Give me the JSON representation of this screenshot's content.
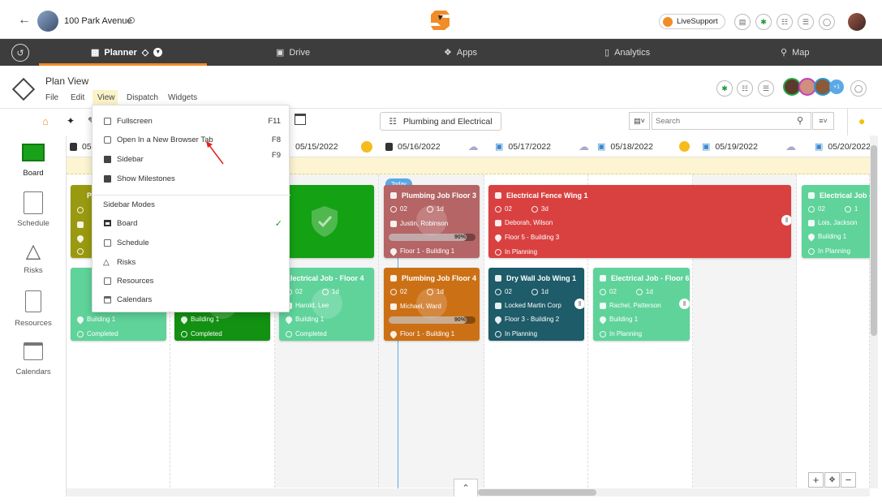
{
  "topbar": {
    "back_icon": "arrow-left-icon",
    "project_name": "100 Park Avenue",
    "support_label": "LiveSupport"
  },
  "nav": {
    "tabs": [
      {
        "label": "Planner",
        "icon": "calendar-icon",
        "active": true
      },
      {
        "label": "Drive",
        "icon": "drive-icon"
      },
      {
        "label": "Apps",
        "icon": "apps-icon"
      },
      {
        "label": "Analytics",
        "icon": "chart-icon"
      },
      {
        "label": "Map",
        "icon": "map-icon"
      }
    ]
  },
  "header": {
    "title": "Plan View",
    "menu": [
      "File",
      "Edit",
      "View",
      "Dispatch",
      "Widgets"
    ],
    "avatar_overflow": "+1"
  },
  "toolbar": {
    "filter_label": "Plumbing and Electrical",
    "search_placeholder": "Search"
  },
  "sidebar": {
    "items": [
      {
        "label": "Board",
        "icon": "board-icon",
        "active": true
      },
      {
        "label": "Schedule",
        "icon": "schedule-icon"
      },
      {
        "label": "Risks",
        "icon": "risk-icon"
      },
      {
        "label": "Resources",
        "icon": "resources-icon"
      },
      {
        "label": "Calendars",
        "icon": "calendars-icon"
      }
    ]
  },
  "dates": {
    "partial": "05",
    "d1": "05/15/2022",
    "d2": "05/16/2022",
    "d3": "05/17/2022",
    "d4": "05/18/2022",
    "d5": "05/19/2022",
    "d6": "05/20/2022",
    "today": "Today"
  },
  "dropdown": {
    "items": [
      {
        "label": "Fullscreen",
        "key": "F11"
      },
      {
        "label": "Open In a New Browser Tab",
        "key": "F8"
      },
      {
        "label": "Sidebar",
        "key": "F9"
      },
      {
        "label": "Show Milestones",
        "key": ""
      }
    ],
    "section_title": "Sidebar Modes",
    "modes": [
      "Board",
      "Schedule",
      "Risks",
      "Resources",
      "Calendars"
    ]
  },
  "cards": {
    "c1": {
      "title": "P",
      "crew": "0",
      "status": "",
      "color": "#9a9a10"
    },
    "c2": {
      "title": "E",
      "crew": "0",
      "company": "S",
      "location": "Building 1",
      "status": "Completed",
      "color": "#5fd39a"
    },
    "c3": {
      "location": "Building 1",
      "status": "Completed",
      "color": "#129112"
    },
    "c4": {
      "color": "#14a114"
    },
    "c5": {
      "title": "Electrical Job - Floor 4",
      "crew": "02",
      "duration": "1d",
      "company": "Harold, Lee",
      "location": "Building 1",
      "status": "Completed",
      "color": "#5fd39a"
    },
    "c6": {
      "title": "Plumbing Job Floor 3",
      "crew": "02",
      "duration": "1d",
      "company": "Justin, Robinson",
      "progress": "90%",
      "location": "Floor 1 - Building 1",
      "color": "#b56565"
    },
    "c7": {
      "title": "Plumbing Job Floor 4",
      "crew": "02",
      "duration": "1d",
      "company": "Michael, Ward",
      "progress": "90%",
      "location": "Floor 1 - Building 1",
      "color": "#cc7016"
    },
    "c8": {
      "title": "Electrical Fence Wing 1",
      "crew": "02",
      "duration": "3d",
      "company": "Deborah, Wilson",
      "location": "Floor 5 - Building 3",
      "status": "In Planning",
      "color": "#d94141"
    },
    "c9": {
      "title": "Dry Wall Job Wing 1",
      "crew": "02",
      "duration": "1d",
      "company": "Locked Martin Corp",
      "location": "Floor 3 - Building 2",
      "status": "In Planning",
      "color": "#1d5c68"
    },
    "c10": {
      "title": "Electrical Job - Floor 6",
      "crew": "02",
      "duration": "1d",
      "company": "Rachel, Patterson",
      "location": "Building 1",
      "status": "In Planning",
      "color": "#5fd39a"
    },
    "c11": {
      "title": "Electrical Job -",
      "crew": "02",
      "duration": "1",
      "company": "Lois, Jackson",
      "location": "Building 1",
      "status": "In Planning",
      "color": "#5fd39a"
    }
  },
  "colors": {
    "accent": "#f28c28",
    "nav_bg": "#3d3d3d",
    "board_green": "#1aa11a"
  }
}
